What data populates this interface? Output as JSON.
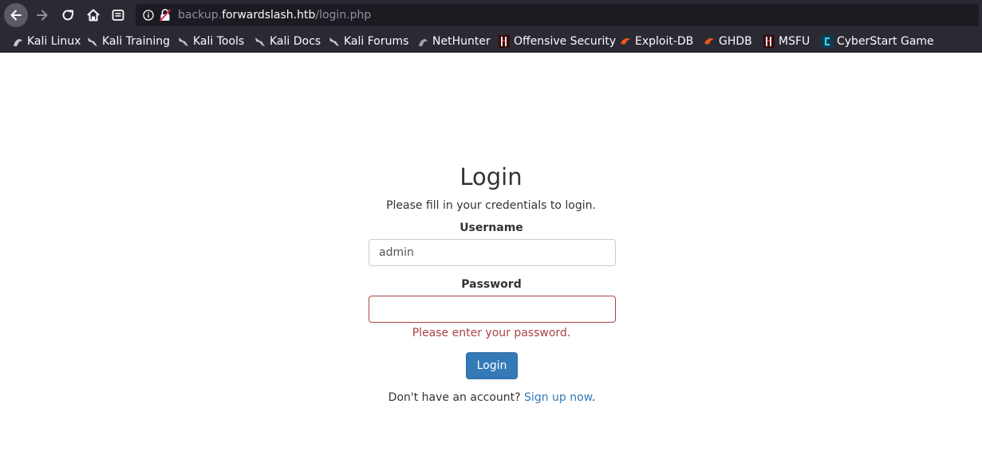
{
  "browser": {
    "url": {
      "subdomain": "backup.",
      "host": "forwardslash.htb",
      "path": "/login.php"
    },
    "bookmarks": [
      {
        "label": "Kali Linux",
        "icon": "kali-dragon-icon"
      },
      {
        "label": "Kali Training",
        "icon": "kali-dragon-icon"
      },
      {
        "label": "Kali Tools",
        "icon": "kali-dragon-icon"
      },
      {
        "label": "Kali Docs",
        "icon": "kali-dragon-icon"
      },
      {
        "label": "Kali Forums",
        "icon": "kali-dragon-icon"
      },
      {
        "label": "NetHunter",
        "icon": "nethunter-icon"
      },
      {
        "label": "Offensive Security",
        "icon": "offsec-icon"
      },
      {
        "label": "Exploit-DB",
        "icon": "exploit-db-icon"
      },
      {
        "label": "GHDB",
        "icon": "exploit-db-icon"
      },
      {
        "label": "MSFU",
        "icon": "offsec-icon"
      },
      {
        "label": "CyberStart Game",
        "icon": "cyberstart-icon"
      }
    ]
  },
  "form": {
    "title": "Login",
    "subtitle": "Please fill in your credentials to login.",
    "username_label": "Username",
    "username_value": "admin",
    "password_label": "Password",
    "password_value": "",
    "password_error": "Please enter your password.",
    "submit_label": "Login",
    "signup_prompt": "Don't have an account?",
    "signup_link": "Sign up now",
    "signup_suffix": "."
  },
  "colors": {
    "chrome": "#2b2a33",
    "url_field": "#1c1b22",
    "primary": "#337ab7",
    "error": "#a94442",
    "text": "#333333"
  }
}
